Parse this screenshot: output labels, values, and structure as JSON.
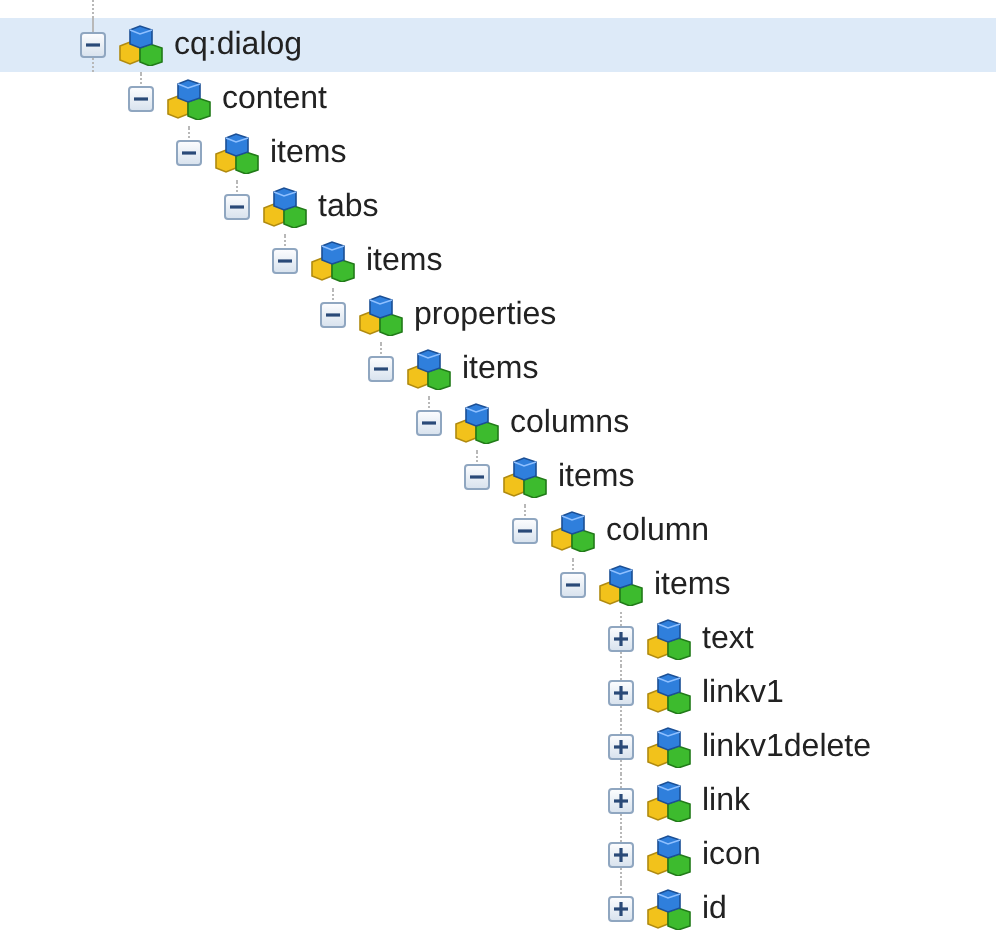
{
  "tree": [
    {
      "label": "cq:dialog",
      "expanded": true,
      "selected": true,
      "children": [
        {
          "label": "content",
          "expanded": true,
          "selected": false,
          "children": [
            {
              "label": "items",
              "expanded": true,
              "selected": false,
              "children": [
                {
                  "label": "tabs",
                  "expanded": true,
                  "selected": false,
                  "children": [
                    {
                      "label": "items",
                      "expanded": true,
                      "selected": false,
                      "children": [
                        {
                          "label": "properties",
                          "expanded": true,
                          "selected": false,
                          "children": [
                            {
                              "label": "items",
                              "expanded": true,
                              "selected": false,
                              "children": [
                                {
                                  "label": "columns",
                                  "expanded": true,
                                  "selected": false,
                                  "children": [
                                    {
                                      "label": "items",
                                      "expanded": true,
                                      "selected": false,
                                      "children": [
                                        {
                                          "label": "column",
                                          "expanded": true,
                                          "selected": false,
                                          "children": [
                                            {
                                              "label": "items",
                                              "expanded": true,
                                              "selected": false,
                                              "children": [
                                                {
                                                  "label": "text",
                                                  "expanded": false,
                                                  "selected": false
                                                },
                                                {
                                                  "label": "linkv1",
                                                  "expanded": false,
                                                  "selected": false
                                                },
                                                {
                                                  "label": "linkv1delete",
                                                  "expanded": false,
                                                  "selected": false
                                                },
                                                {
                                                  "label": "link",
                                                  "expanded": false,
                                                  "selected": false
                                                },
                                                {
                                                  "label": "icon",
                                                  "expanded": false,
                                                  "selected": false
                                                },
                                                {
                                                  "label": "id",
                                                  "expanded": false,
                                                  "selected": false
                                                }
                                              ]
                                            }
                                          ]
                                        }
                                      ]
                                    }
                                  ]
                                }
                              ]
                            }
                          ]
                        }
                      ]
                    }
                  ]
                }
              ]
            }
          ]
        }
      ]
    }
  ]
}
